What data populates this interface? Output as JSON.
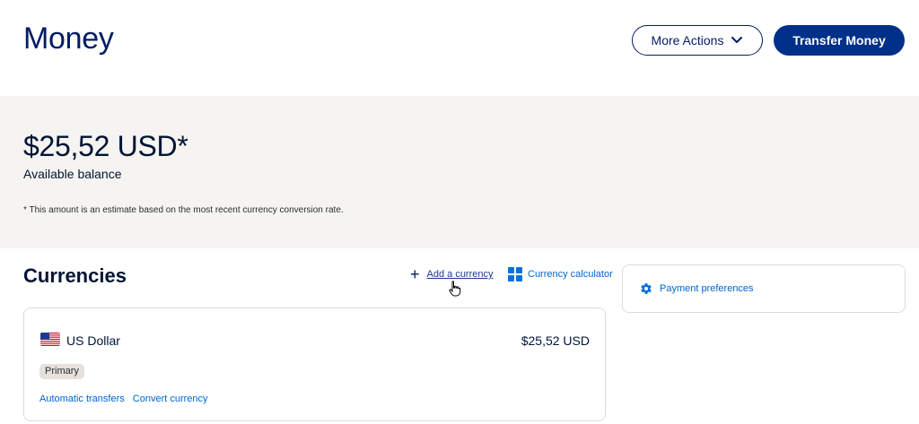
{
  "header": {
    "title": "Money",
    "more_actions_label": "More Actions",
    "transfer_label": "Transfer Money"
  },
  "balance": {
    "amount": "$25,52 USD*",
    "label": "Available balance",
    "note": "* This amount is an estimate based on the most recent currency conversion rate."
  },
  "currencies": {
    "title": "Currencies",
    "add_label": "Add a currency",
    "calculator_label": "Currency calculator",
    "items": [
      {
        "name": "US Dollar",
        "amount": "$25,52 USD",
        "badge": "Primary",
        "links": [
          "Automatic transfers",
          "Convert currency"
        ]
      }
    ]
  },
  "sidebar": {
    "payment_preferences_label": "Payment preferences"
  },
  "colors": {
    "brand_navy": "#001c64",
    "button_blue": "#003087",
    "link_blue": "#0065cc",
    "band_bg": "#f5f4f0"
  },
  "icons": [
    "chevron-down-icon",
    "plus-icon",
    "calculator-icon",
    "us-flag-icon",
    "gear-icon",
    "hand-cursor-icon"
  ]
}
